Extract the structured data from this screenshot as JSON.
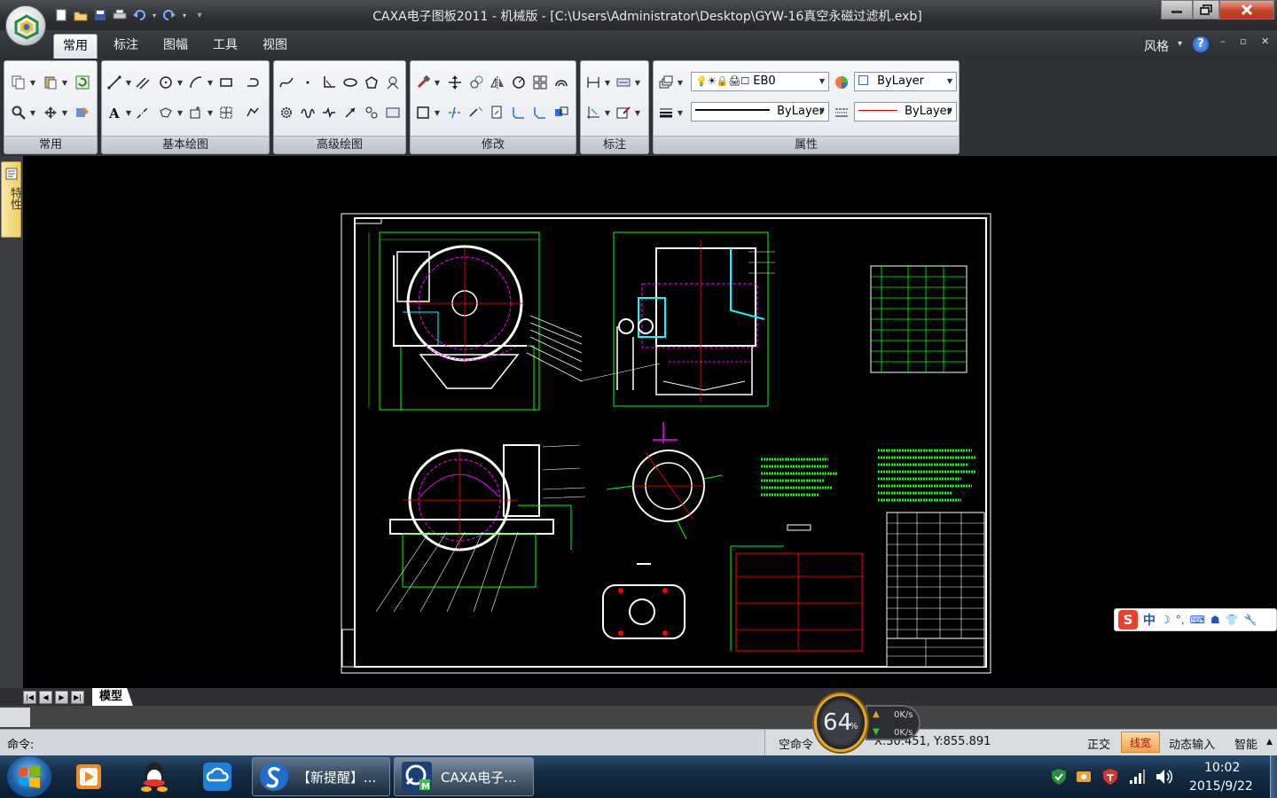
{
  "window": {
    "title": "CAXA电子图板2011 - 机械版 - [C:\\Users\\Administrator\\Desktop\\GYW-16真空永磁过滤机.exb]"
  },
  "quick_access": [
    "new-icon",
    "open-icon",
    "save-icon",
    "print-icon",
    "undo-icon",
    "redo-icon",
    "customize-icon"
  ],
  "tabs": [
    "常用",
    "标注",
    "图幅",
    "工具",
    "视图"
  ],
  "active_tab": "常用",
  "style_menu": "风格",
  "ribbon": {
    "groups": [
      "常用",
      "基本绘图",
      "高级绘图",
      "修改",
      "标注",
      "属性"
    ],
    "layer_value": "EB0",
    "color_value": "ByLayer",
    "linetype_value": "ByLayer",
    "lineweight_value": "ByLayer"
  },
  "palette_tab": "特性",
  "model_tab": "模型",
  "command": {
    "label": "命令:"
  },
  "status": {
    "idle": "空命令",
    "coords": "X:30.451, Y:855.891",
    "ortho": "正交",
    "linewidth": "线宽",
    "dynamic_input": "动态输入",
    "smart": "智能"
  },
  "gauge": {
    "value": "64",
    "unit": "%",
    "up": "0K/s",
    "down": "0K/s"
  },
  "taskbar": {
    "buttons": [
      "【新提醒】...",
      "CAXA电子..."
    ],
    "time": "10:02",
    "date": "2015/9/22"
  },
  "ime": {
    "label": "中"
  },
  "colors": {
    "accent_orange": "#f1a54c",
    "drawing_bg": "#000000",
    "cad_green": "#00ff00",
    "cad_magenta": "#ff00ff",
    "cad_cyan": "#00ffff",
    "cad_red": "#ff0000"
  }
}
